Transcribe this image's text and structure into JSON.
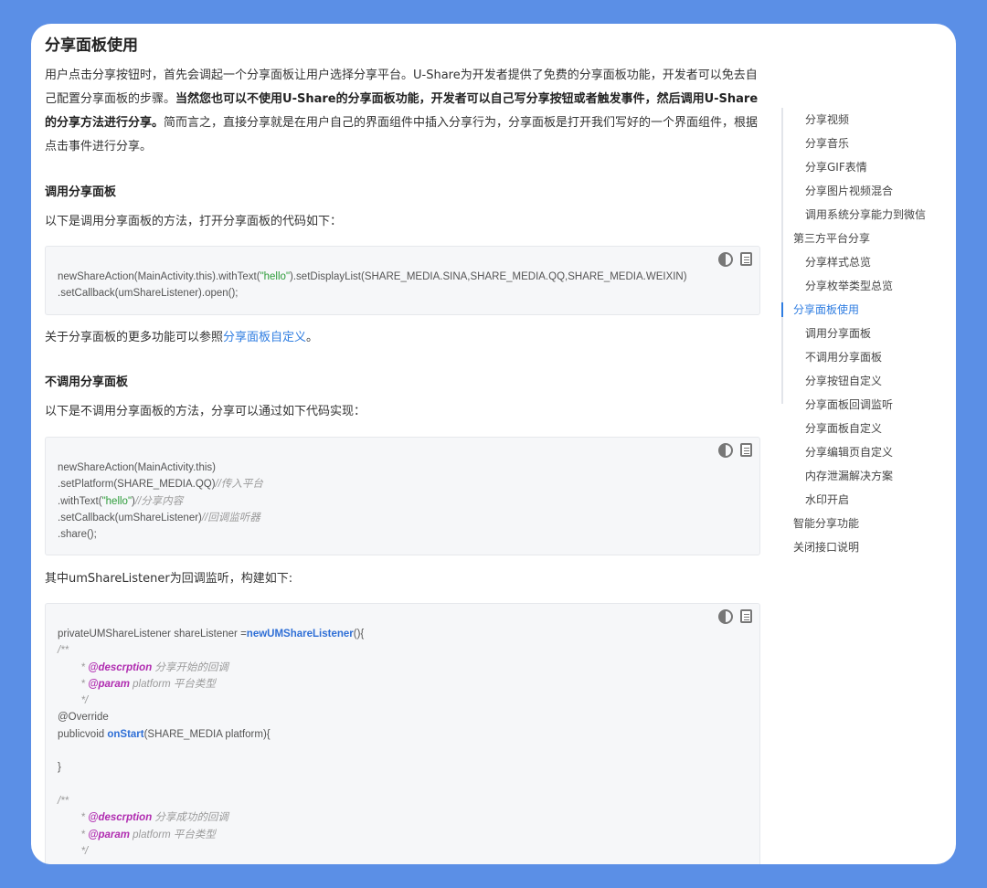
{
  "title": "分享面板使用",
  "intro": {
    "p1": "用户点击分享按钮时，首先会调起一个分享面板让用户选择分享平台。U-Share为开发者提供了免费的分享面板功能，开发者可以免去自己配置分享面板的步骤。",
    "bold": "当然您也可以不使用U-Share的分享面板功能，开发者可以自己写分享按钮或者触发事件，然后调用U-Share的分享方法进行分享。",
    "p2": "简而言之，直接分享就是在用户自己的界面组件中插入分享行为，分享面板是打开我们写好的一个界面组件，根据点击事件进行分享。"
  },
  "section1": {
    "heading": "调用分享面板",
    "desc": "以下是调用分享面板的方法，打开分享面板的代码如下：",
    "code": [
      [
        "newShareAction(MainActivity.this).withText(",
        "\"hello\"",
        ").setDisplayList(SHARE_MEDIA.SINA,SHARE_MEDIA.QQ,SHARE_MEDIA.WEIXIN)"
      ],
      [
        ".setCallback(umShareListener).open();"
      ]
    ],
    "more_prefix": "关于分享面板的更多功能可以参照",
    "more_link": "分享面板自定义",
    "more_suffix": "。"
  },
  "section2": {
    "heading": "不调用分享面板",
    "desc": "以下是不调用分享面板的方法，分享可以通过如下代码实现：",
    "code": [
      {
        "code": "newShareAction(MainActivity.this)",
        "comment": ""
      },
      {
        "code": ".setPlatform(SHARE_MEDIA.QQ)",
        "comment": "//传入平台"
      },
      {
        "code_a": ".withText(",
        "str": "\"hello\"",
        "code_b": ")",
        "comment": "//分享内容"
      },
      {
        "code": ".setCallback(umShareListener)",
        "comment": "//回调监听器"
      },
      {
        "code": ".share();",
        "comment": ""
      }
    ],
    "listener_desc": "其中umShareListener为回调监听，构建如下:"
  },
  "section3": {
    "line1_a": "privateUMShareListener shareListener =",
    "line1_kw": "newUMShareListener",
    "line1_b": "(){",
    "doc_open": "/**",
    "doc1_tag": "@descrption",
    "doc1_text": " 分享开始的回调",
    "doc2_tag": "@param",
    "doc2_text": " platform 平台类型",
    "doc_close": "*/",
    "override": "@Override",
    "method_a": "publicvoid ",
    "method_kw": "onStart",
    "method_b": "(SHARE_MEDIA platform){",
    "brace_close": "}",
    "doc3_tag": "@descrption",
    "doc3_text": " 分享成功的回调",
    "doc4_tag": "@param",
    "doc4_text": " platform 平台类型"
  },
  "toc": [
    {
      "label": "分享视频",
      "level": 2
    },
    {
      "label": "分享音乐",
      "level": 2
    },
    {
      "label": "分享GIF表情",
      "level": 2
    },
    {
      "label": "分享图片视频混合",
      "level": 2
    },
    {
      "label": "调用系统分享能力到微信",
      "level": 2
    },
    {
      "label": "第三方平台分享",
      "level": 1
    },
    {
      "label": "分享样式总览",
      "level": 2
    },
    {
      "label": "分享枚举类型总览",
      "level": 2
    },
    {
      "label": "分享面板使用",
      "level": 1,
      "active": true
    },
    {
      "label": "调用分享面板",
      "level": 2
    },
    {
      "label": "不调用分享面板",
      "level": 2
    },
    {
      "label": "分享按钮自定义",
      "level": 2
    },
    {
      "label": "分享面板回调监听",
      "level": 2
    },
    {
      "label": "分享面板自定义",
      "level": 2
    },
    {
      "label": "分享编辑页自定义",
      "level": 2
    },
    {
      "label": "内存泄漏解决方案",
      "level": 2
    },
    {
      "label": "水印开启",
      "level": 2
    },
    {
      "label": "智能分享功能",
      "level": 1
    },
    {
      "label": "关闭接口说明",
      "level": 1
    }
  ],
  "colors": {
    "background": "#5b8fe6",
    "link": "#2f7de1",
    "string": "#2e9c3a",
    "annotation": "#b02cb0",
    "keyword": "#2f6fd6"
  },
  "icons": [
    "theme-toggle-icon",
    "copy-icon"
  ]
}
